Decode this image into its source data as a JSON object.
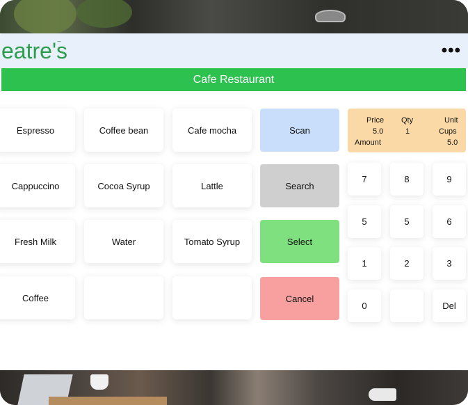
{
  "app": {
    "logo_text": "eatre's",
    "title": "Cafe Restaurant",
    "menu_icon": "more-dots-icon"
  },
  "products": [
    {
      "label": "Espresso"
    },
    {
      "label": "Coffee bean"
    },
    {
      "label": "Cafe mocha"
    },
    {
      "label": "Cappuccino"
    },
    {
      "label": "Cocoa Syrup"
    },
    {
      "label": "Lattle"
    },
    {
      "label": "Fresh Milk"
    },
    {
      "label": "Water"
    },
    {
      "label": "Tomato Syrup"
    },
    {
      "label": "Coffee"
    },
    {
      "label": ""
    },
    {
      "label": ""
    }
  ],
  "actions": {
    "scan": {
      "label": "Scan",
      "color": "#c9defa"
    },
    "search": {
      "label": "Search",
      "color": "#cfcfcf"
    },
    "select": {
      "label": "Select",
      "color": "#7fe07f"
    },
    "cancel": {
      "label": "Cancel",
      "color": "#f8a0a0"
    }
  },
  "display": {
    "price_label": "Price",
    "price_value": "5.0",
    "qty_label": "Qty",
    "qty_value": "1",
    "unit_label": "Unit",
    "unit_value": "Cups",
    "amount_label": "Amount",
    "amount_value": "5.0",
    "background": "#fbd9a6"
  },
  "keypad": [
    [
      "7",
      "8",
      "9"
    ],
    [
      "5",
      "5",
      "6"
    ],
    [
      "1",
      "2",
      "3"
    ],
    [
      "0",
      "",
      "Del"
    ]
  ],
  "colors": {
    "brand_green": "#2dc14f",
    "header_bg": "#e7f0fb"
  }
}
